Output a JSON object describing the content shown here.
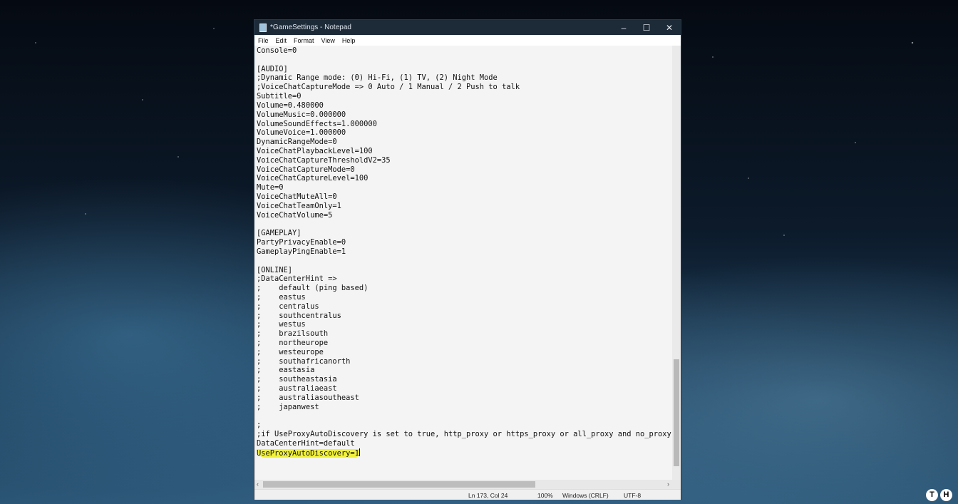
{
  "window": {
    "title": "*GameSettings - Notepad",
    "minimize": "–",
    "maximize": "☐",
    "close": "✕"
  },
  "menu": [
    "File",
    "Edit",
    "Format",
    "View",
    "Help"
  ],
  "editor": {
    "lines": [
      "Console=0",
      "",
      "[AUDIO]",
      ";Dynamic Range mode: (0) Hi-Fi, (1) TV, (2) Night Mode",
      ";VoiceChatCaptureMode => 0 Auto / 1 Manual / 2 Push to talk",
      "Subtitle=0",
      "Volume=0.480000",
      "VolumeMusic=0.000000",
      "VolumeSoundEffects=1.000000",
      "VolumeVoice=1.000000",
      "DynamicRangeMode=0",
      "VoiceChatPlaybackLevel=100",
      "VoiceChatCaptureThresholdV2=35",
      "VoiceChatCaptureMode=0",
      "VoiceChatCaptureLevel=100",
      "Mute=0",
      "VoiceChatMuteAll=0",
      "VoiceChatTeamOnly=1",
      "VoiceChatVolume=5",
      "",
      "[GAMEPLAY]",
      "PartyPrivacyEnable=0",
      "GameplayPingEnable=1",
      "",
      "[ONLINE]",
      ";DataCenterHint =>",
      ";    default (ping based)",
      ";    eastus",
      ";    centralus",
      ";    southcentralus",
      ";    westus",
      ";    brazilsouth",
      ";    northeurope",
      ";    westeurope",
      ";    southafricanorth",
      ";    eastasia",
      ";    southeastasia",
      ";    australiaeast",
      ";    australiasoutheast",
      ";    japanwest",
      "",
      ";",
      ";if UseProxyAutoDiscovery is set to true, http_proxy or https_proxy or all_proxy and no_proxy are goin",
      "DataCenterHint=default"
    ],
    "highlighted_line": "UseProxyAutoDiscovery=1"
  },
  "status": {
    "position": "Ln 173, Col 24",
    "zoom": "100%",
    "line_ending": "Windows (CRLF)",
    "encoding": "UTF-8"
  },
  "watermark": [
    "T",
    "H"
  ]
}
